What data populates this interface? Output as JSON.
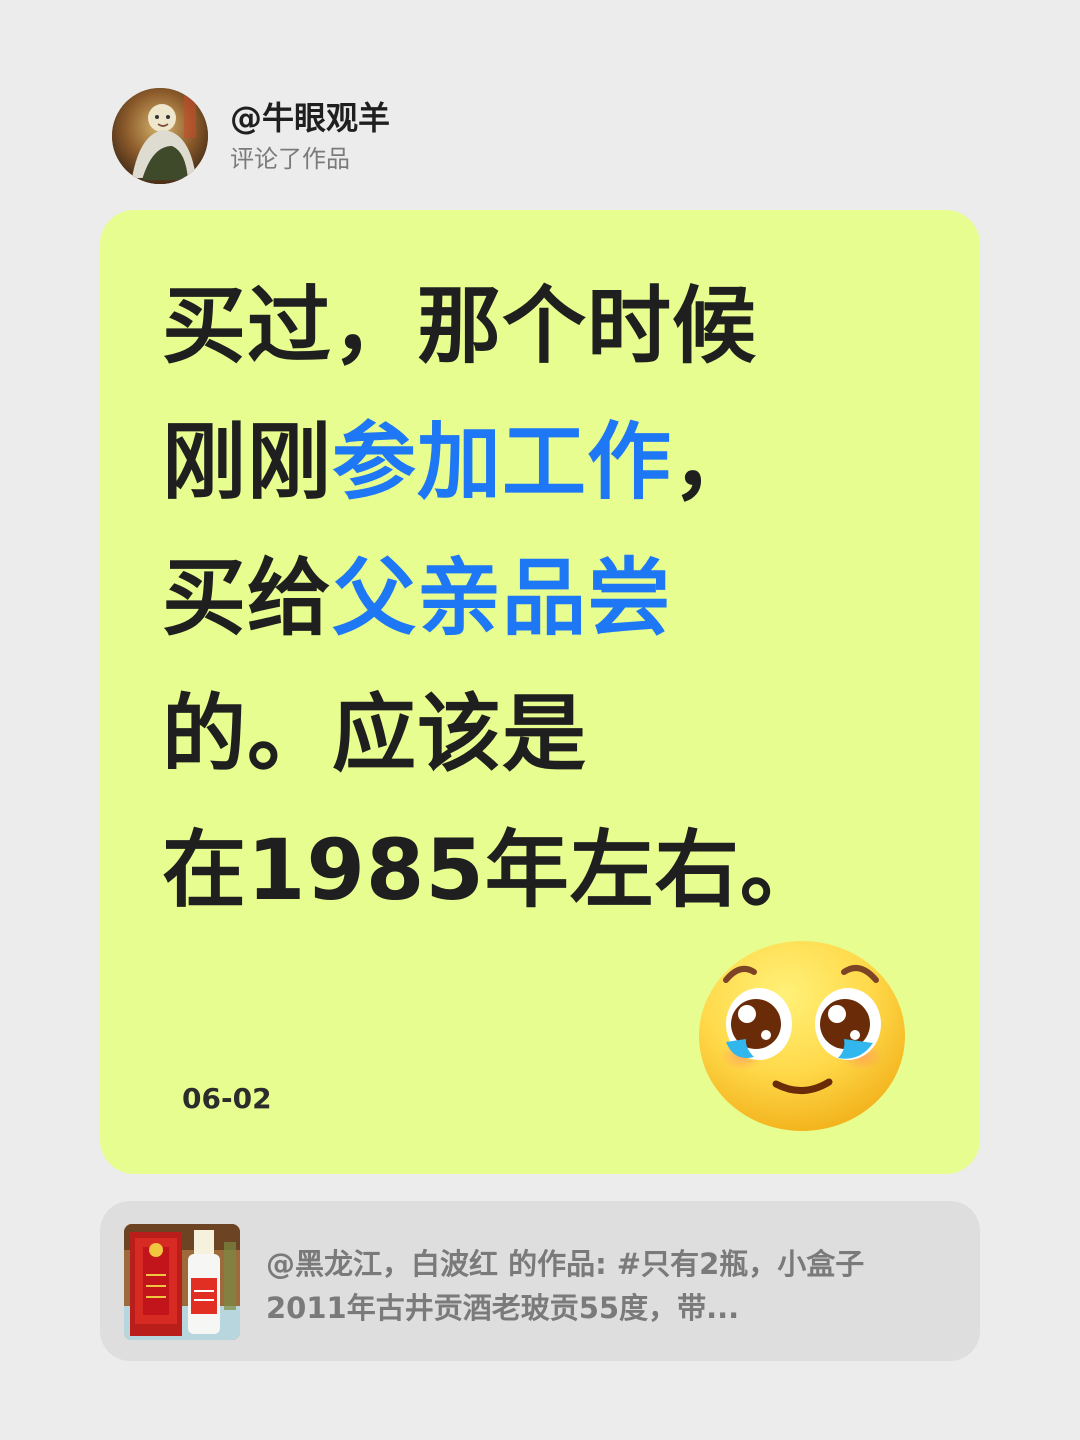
{
  "header": {
    "username": "@牛眼观羊",
    "action": "评论了作品"
  },
  "comment": {
    "lines": [
      [
        {
          "text": "买过，那个时候",
          "highlight": false
        }
      ],
      [
        {
          "text": "刚刚",
          "highlight": false
        },
        {
          "text": "参加工作",
          "highlight": true
        },
        {
          "text": "，",
          "highlight": false
        }
      ],
      [
        {
          "text": "买给",
          "highlight": false
        },
        {
          "text": "父亲品尝",
          "highlight": true
        }
      ],
      [
        {
          "text": "的。应该是",
          "highlight": false
        }
      ],
      [
        {
          "text": "在1985年左右。",
          "highlight": false
        }
      ]
    ],
    "date": "06-02",
    "emoji": "pleading-face-icon"
  },
  "source": {
    "text": "@黑龙江，白波红 的作品: #只有2瓶，小盒子2011年古井贡酒老玻贡55度，带..."
  },
  "colors": {
    "page_background": "#ececec",
    "comment_card": "#e7fd8f",
    "highlight": "#1e78f5",
    "source_card": "#dedede"
  }
}
